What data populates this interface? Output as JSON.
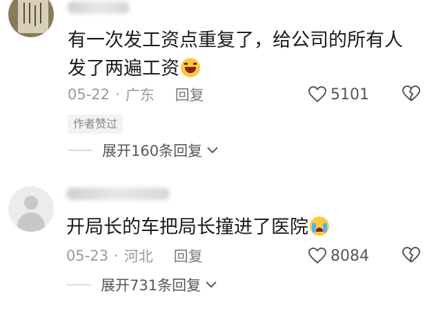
{
  "comments": [
    {
      "text": "有一次发工资点重复了，给公司的所有人发了两遍工资",
      "emoji": "laughing-face-emoji",
      "date": "05-22",
      "location": "广东",
      "reply_label": "回复",
      "likes": "5101",
      "author_badge": "作者赞过",
      "expand_label": "展开160条回复"
    },
    {
      "text": "开局长的车把局长撞进了医院",
      "emoji": "crying-face-emoji",
      "date": "05-23",
      "location": "河北",
      "reply_label": "回复",
      "likes": "8084",
      "expand_label": "展开731条回复"
    }
  ]
}
